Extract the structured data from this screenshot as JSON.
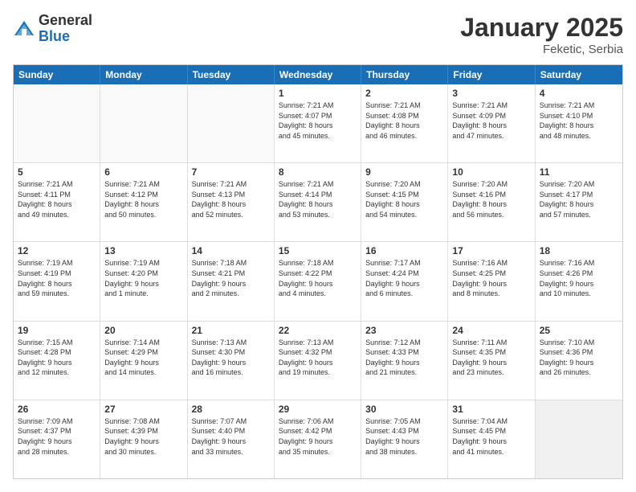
{
  "header": {
    "logo_general": "General",
    "logo_blue": "Blue",
    "title": "January 2025",
    "subtitle": "Feketic, Serbia"
  },
  "calendar": {
    "days_of_week": [
      "Sunday",
      "Monday",
      "Tuesday",
      "Wednesday",
      "Thursday",
      "Friday",
      "Saturday"
    ],
    "weeks": [
      [
        {
          "day": "",
          "info": "",
          "empty": true
        },
        {
          "day": "",
          "info": "",
          "empty": true
        },
        {
          "day": "",
          "info": "",
          "empty": true
        },
        {
          "day": "1",
          "info": "Sunrise: 7:21 AM\nSunset: 4:07 PM\nDaylight: 8 hours\nand 45 minutes.",
          "empty": false
        },
        {
          "day": "2",
          "info": "Sunrise: 7:21 AM\nSunset: 4:08 PM\nDaylight: 8 hours\nand 46 minutes.",
          "empty": false
        },
        {
          "day": "3",
          "info": "Sunrise: 7:21 AM\nSunset: 4:09 PM\nDaylight: 8 hours\nand 47 minutes.",
          "empty": false
        },
        {
          "day": "4",
          "info": "Sunrise: 7:21 AM\nSunset: 4:10 PM\nDaylight: 8 hours\nand 48 minutes.",
          "empty": false
        }
      ],
      [
        {
          "day": "5",
          "info": "Sunrise: 7:21 AM\nSunset: 4:11 PM\nDaylight: 8 hours\nand 49 minutes.",
          "empty": false
        },
        {
          "day": "6",
          "info": "Sunrise: 7:21 AM\nSunset: 4:12 PM\nDaylight: 8 hours\nand 50 minutes.",
          "empty": false
        },
        {
          "day": "7",
          "info": "Sunrise: 7:21 AM\nSunset: 4:13 PM\nDaylight: 8 hours\nand 52 minutes.",
          "empty": false
        },
        {
          "day": "8",
          "info": "Sunrise: 7:21 AM\nSunset: 4:14 PM\nDaylight: 8 hours\nand 53 minutes.",
          "empty": false
        },
        {
          "day": "9",
          "info": "Sunrise: 7:20 AM\nSunset: 4:15 PM\nDaylight: 8 hours\nand 54 minutes.",
          "empty": false
        },
        {
          "day": "10",
          "info": "Sunrise: 7:20 AM\nSunset: 4:16 PM\nDaylight: 8 hours\nand 56 minutes.",
          "empty": false
        },
        {
          "day": "11",
          "info": "Sunrise: 7:20 AM\nSunset: 4:17 PM\nDaylight: 8 hours\nand 57 minutes.",
          "empty": false
        }
      ],
      [
        {
          "day": "12",
          "info": "Sunrise: 7:19 AM\nSunset: 4:19 PM\nDaylight: 8 hours\nand 59 minutes.",
          "empty": false
        },
        {
          "day": "13",
          "info": "Sunrise: 7:19 AM\nSunset: 4:20 PM\nDaylight: 9 hours\nand 1 minute.",
          "empty": false
        },
        {
          "day": "14",
          "info": "Sunrise: 7:18 AM\nSunset: 4:21 PM\nDaylight: 9 hours\nand 2 minutes.",
          "empty": false
        },
        {
          "day": "15",
          "info": "Sunrise: 7:18 AM\nSunset: 4:22 PM\nDaylight: 9 hours\nand 4 minutes.",
          "empty": false
        },
        {
          "day": "16",
          "info": "Sunrise: 7:17 AM\nSunset: 4:24 PM\nDaylight: 9 hours\nand 6 minutes.",
          "empty": false
        },
        {
          "day": "17",
          "info": "Sunrise: 7:16 AM\nSunset: 4:25 PM\nDaylight: 9 hours\nand 8 minutes.",
          "empty": false
        },
        {
          "day": "18",
          "info": "Sunrise: 7:16 AM\nSunset: 4:26 PM\nDaylight: 9 hours\nand 10 minutes.",
          "empty": false
        }
      ],
      [
        {
          "day": "19",
          "info": "Sunrise: 7:15 AM\nSunset: 4:28 PM\nDaylight: 9 hours\nand 12 minutes.",
          "empty": false
        },
        {
          "day": "20",
          "info": "Sunrise: 7:14 AM\nSunset: 4:29 PM\nDaylight: 9 hours\nand 14 minutes.",
          "empty": false
        },
        {
          "day": "21",
          "info": "Sunrise: 7:13 AM\nSunset: 4:30 PM\nDaylight: 9 hours\nand 16 minutes.",
          "empty": false
        },
        {
          "day": "22",
          "info": "Sunrise: 7:13 AM\nSunset: 4:32 PM\nDaylight: 9 hours\nand 19 minutes.",
          "empty": false
        },
        {
          "day": "23",
          "info": "Sunrise: 7:12 AM\nSunset: 4:33 PM\nDaylight: 9 hours\nand 21 minutes.",
          "empty": false
        },
        {
          "day": "24",
          "info": "Sunrise: 7:11 AM\nSunset: 4:35 PM\nDaylight: 9 hours\nand 23 minutes.",
          "empty": false
        },
        {
          "day": "25",
          "info": "Sunrise: 7:10 AM\nSunset: 4:36 PM\nDaylight: 9 hours\nand 26 minutes.",
          "empty": false
        }
      ],
      [
        {
          "day": "26",
          "info": "Sunrise: 7:09 AM\nSunset: 4:37 PM\nDaylight: 9 hours\nand 28 minutes.",
          "empty": false
        },
        {
          "day": "27",
          "info": "Sunrise: 7:08 AM\nSunset: 4:39 PM\nDaylight: 9 hours\nand 30 minutes.",
          "empty": false
        },
        {
          "day": "28",
          "info": "Sunrise: 7:07 AM\nSunset: 4:40 PM\nDaylight: 9 hours\nand 33 minutes.",
          "empty": false
        },
        {
          "day": "29",
          "info": "Sunrise: 7:06 AM\nSunset: 4:42 PM\nDaylight: 9 hours\nand 35 minutes.",
          "empty": false
        },
        {
          "day": "30",
          "info": "Sunrise: 7:05 AM\nSunset: 4:43 PM\nDaylight: 9 hours\nand 38 minutes.",
          "empty": false
        },
        {
          "day": "31",
          "info": "Sunrise: 7:04 AM\nSunset: 4:45 PM\nDaylight: 9 hours\nand 41 minutes.",
          "empty": false
        },
        {
          "day": "",
          "info": "",
          "empty": true,
          "shaded": true
        }
      ]
    ]
  }
}
